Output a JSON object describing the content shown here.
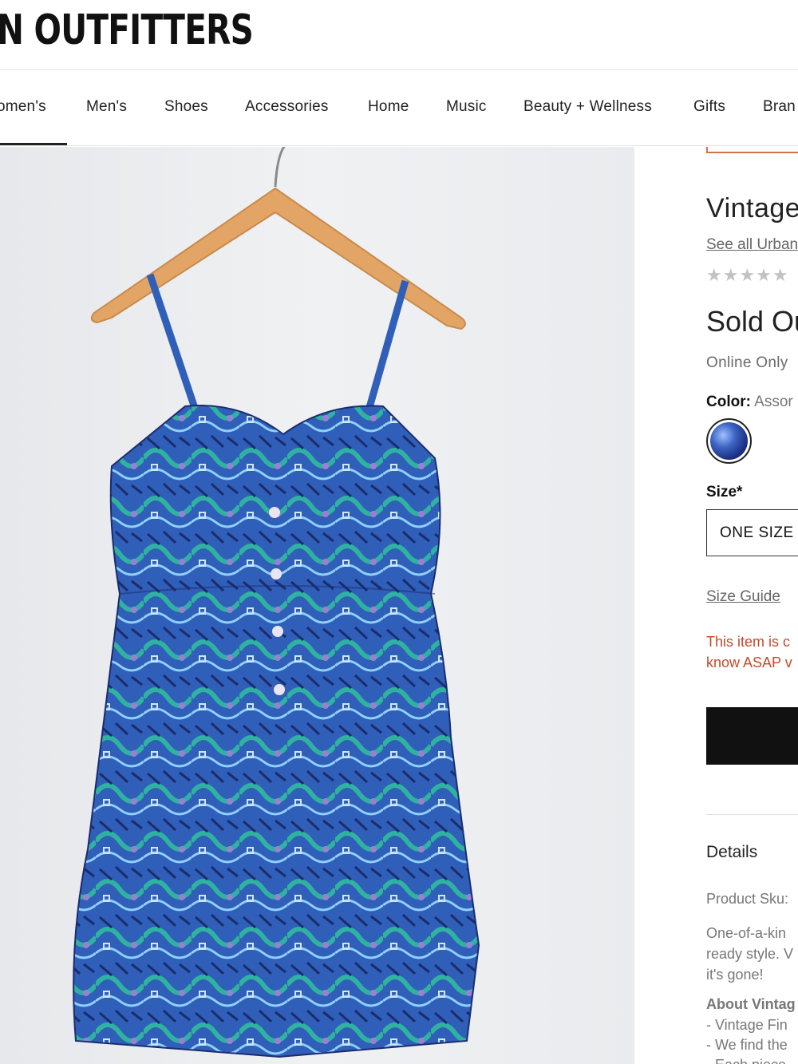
{
  "header": {
    "logo_text": "N OUTFITTERS"
  },
  "nav": {
    "items": [
      "omen's",
      "Men's",
      "Shoes",
      "Accessories",
      "Home",
      "Music",
      "Beauty + Wellness",
      "Gifts",
      "Bran"
    ]
  },
  "product": {
    "image_alt": "Vintage blue patterned dress on wooden hanger",
    "title": "Vintage",
    "see_all": "See all Urban",
    "rating_stars": "★★★★★",
    "price_status": "Sold Ou",
    "availability": "Online Only",
    "color_label": "Color:",
    "color_value": "Assor",
    "size_label": "Size*",
    "size_value": "ONE SIZE",
    "size_guide": "Size Guide",
    "notice_line1": "This item is c",
    "notice_line2": "know ASAP v",
    "details_heading": "Details",
    "sku_text": "Product Sku:",
    "description_line1": "One-of-a-kin",
    "description_line2": "ready style. V",
    "description_line3": "it's gone!",
    "about_heading": "About Vintag",
    "bullet1": "- Vintage Fin",
    "bullet2": "- We find the",
    "bullet3": "- Each piece"
  },
  "colors": {
    "accent_red": "#c44a2a",
    "button_black": "#111111",
    "dress_blue": "#2f5fb8"
  }
}
